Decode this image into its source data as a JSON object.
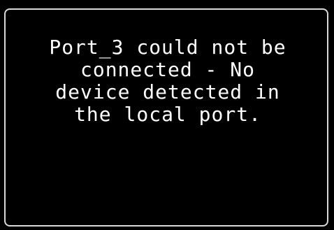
{
  "dialog": {
    "message_lines": [
      "Port_3 could not be",
      "connected - No",
      "device detected in",
      "the local port."
    ]
  },
  "colors": {
    "background": "#000000",
    "text": "#ffffff",
    "border": "#d9d9d9"
  }
}
